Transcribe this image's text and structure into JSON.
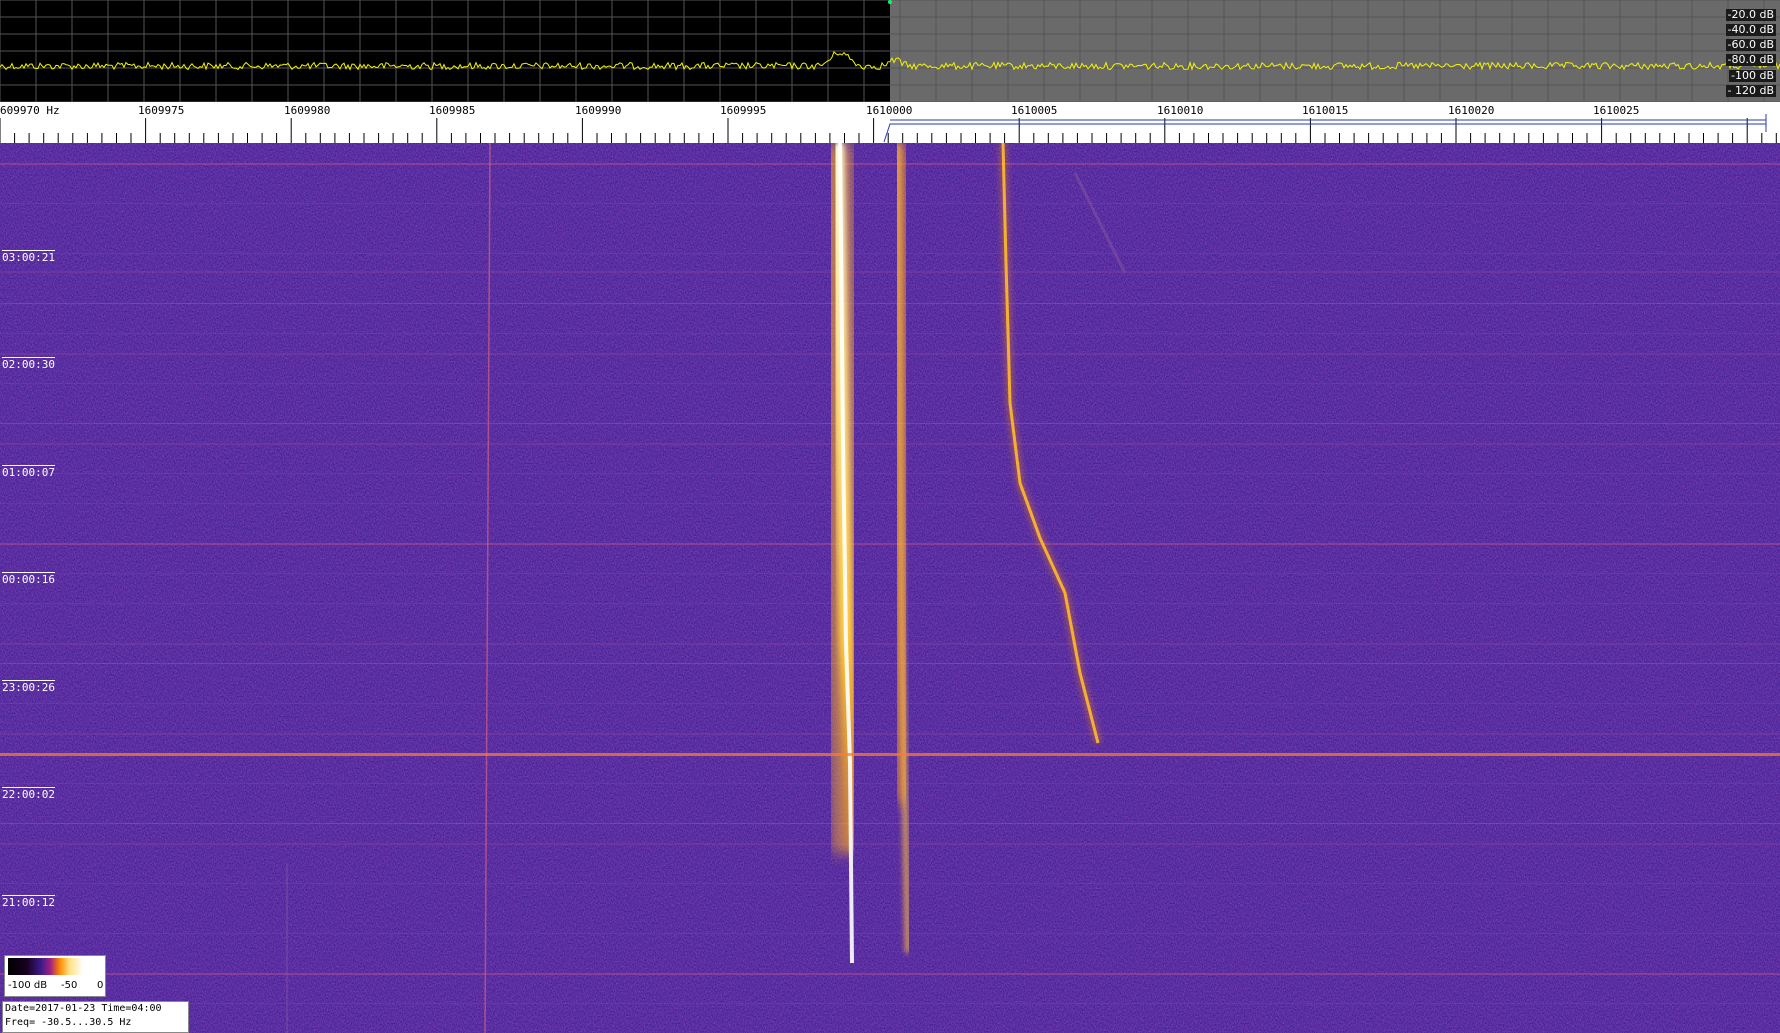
{
  "spectrum": {
    "db_scale": [
      "-20.0 dB",
      "-40.0 dB",
      "-60.0 dB",
      "-80.0 dB",
      "-100 dB",
      "- 120 dB"
    ]
  },
  "ruler": {
    "freq_labels": [
      "609970 Hz",
      "1609975",
      "1609980",
      "1609985",
      "1609990",
      "1609995",
      "1610000",
      "1610005",
      "1610010",
      "1610015",
      "1610020",
      "1610025"
    ]
  },
  "waterfall": {
    "time_labels": [
      "03:00:21",
      "02:00:30",
      "01:00:07",
      "00:00:16",
      "23:00:26",
      "22:00:02",
      "21:00:12"
    ]
  },
  "colorbar": {
    "min_label": "-100 dB",
    "mid_label": "-50",
    "max_label": "0"
  },
  "info": {
    "date_line": "Date=2017-01-23 Time=04:00",
    "freq_line": "Freq= -30.5...30.5 Hz"
  }
}
